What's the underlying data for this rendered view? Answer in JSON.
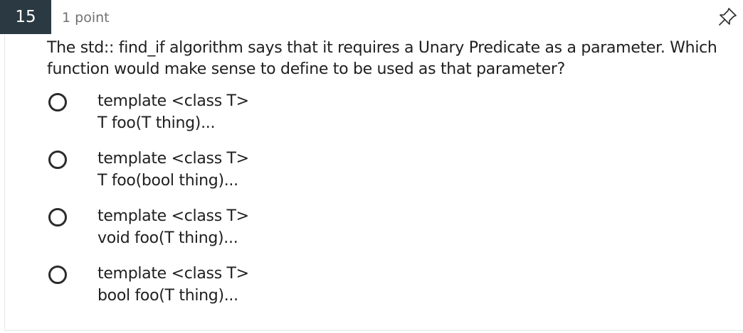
{
  "question": {
    "number": "15",
    "points": "1 point",
    "text": "The std:: find_if algorithm says that it requires a Unary Predicate as a parameter. Which function would make sense to define to be used as that parameter?",
    "pin_icon": "pin-icon"
  },
  "options": [
    {
      "line1": "template <class T>",
      "line2": "T foo(T thing)..."
    },
    {
      "line1": "template <class T>",
      "line2": "T foo(bool thing)..."
    },
    {
      "line1": "template <class T>",
      "line2": "void foo(T thing)..."
    },
    {
      "line1": "template <class T>",
      "line2": "bool foo(T thing)..."
    }
  ]
}
